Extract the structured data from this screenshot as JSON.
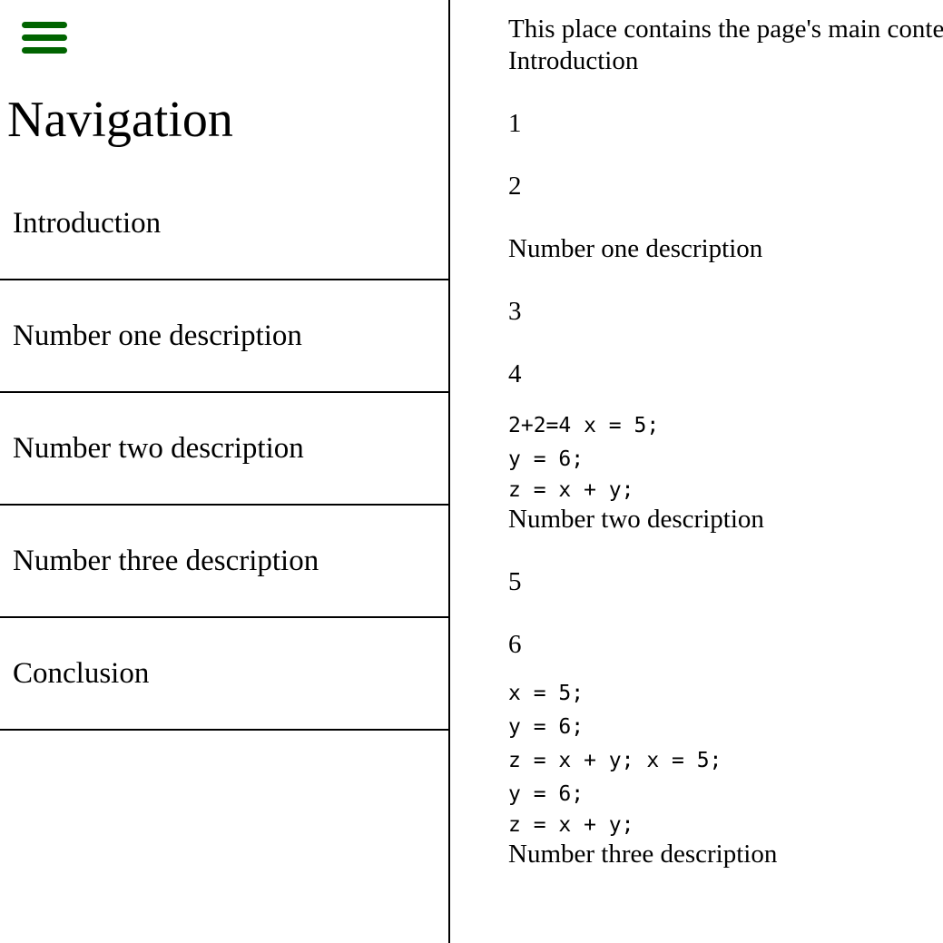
{
  "sidebar": {
    "menu_icon": "hamburger-menu-icon",
    "menu_color": "#006400",
    "title": "Navigation",
    "items": [
      {
        "label": "Introduction"
      },
      {
        "label": "Number one description"
      },
      {
        "label": "Number two description"
      },
      {
        "label": "Number three description"
      },
      {
        "label": "Conclusion"
      }
    ]
  },
  "main": {
    "intro_text": "This place contains the page's main content",
    "blocks": [
      {
        "text": "Introduction"
      },
      {
        "text": "1"
      },
      {
        "text": "2"
      },
      {
        "text": "Number one description"
      },
      {
        "text": "3"
      },
      {
        "text": "4"
      },
      {
        "text": "2+2=4 x = 5;"
      },
      {
        "text": "y = 6;"
      },
      {
        "text": "z = x + y;"
      },
      {
        "text": "Number two description"
      },
      {
        "text": "5"
      },
      {
        "text": "6"
      },
      {
        "text": "x = 5;"
      },
      {
        "text": "y = 6;"
      },
      {
        "text": "z = x + y; x = 5;"
      },
      {
        "text": "y = 6;"
      },
      {
        "text": "z = x + y;"
      },
      {
        "text": "Number three description"
      }
    ]
  }
}
